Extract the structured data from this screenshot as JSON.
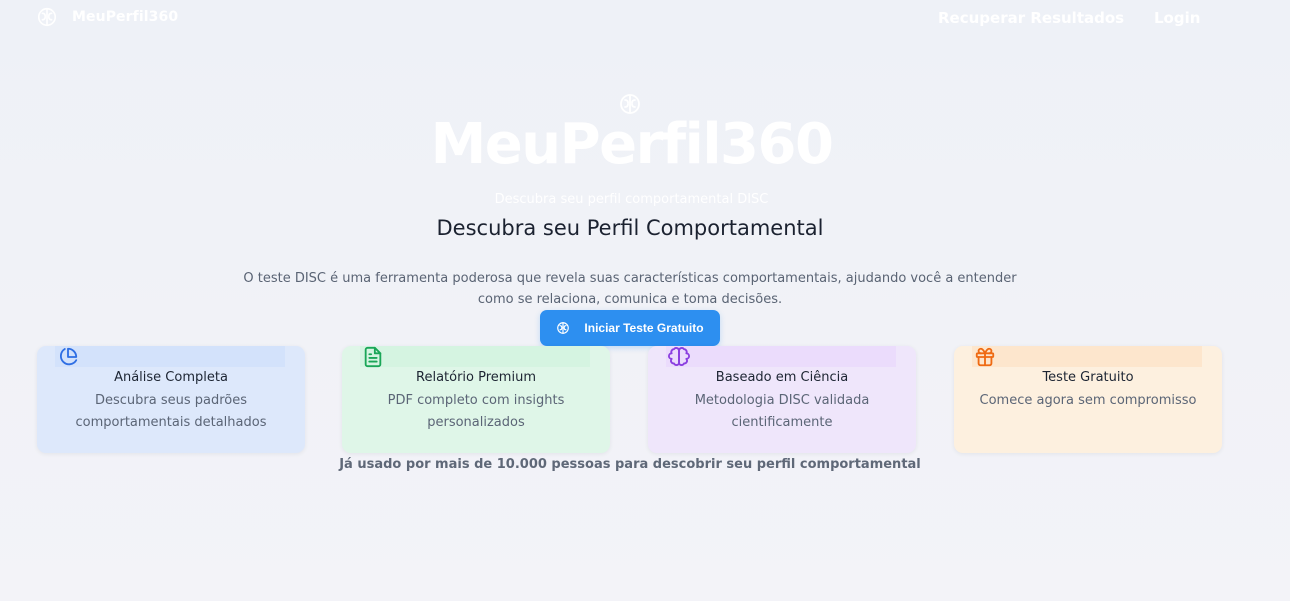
{
  "nav": {
    "brand": "MeuPerfil360",
    "brand_icon": "brain-icon",
    "links": [
      "Recuperar Resultados",
      "Login"
    ]
  },
  "hero": {
    "icon": "brain-icon",
    "title": "MeuPerfil360",
    "subtitle": "Descubra seu perfil comportamental DISC"
  },
  "main": {
    "heading": "Descubra seu Perfil Comportamental",
    "description": "O teste DISC é uma ferramenta poderosa que revela suas características comportamentais, ajudando você a entender como se relaciona, comunica e toma decisões.",
    "cta_label": "Iniciar Teste Gratuito",
    "cta_icon": "brain-icon"
  },
  "features": [
    {
      "icon": "pie-chart-icon",
      "title": "Análise Completa",
      "text": "Descubra seus padrões comportamentais detalhados",
      "accent": "#2f6fe4"
    },
    {
      "icon": "file-text-icon",
      "title": "Relatório Premium",
      "text": "PDF completo com insights personalizados",
      "accent": "#1aa657"
    },
    {
      "icon": "brain-icon",
      "title": "Baseado em Ciência",
      "text": "Metodologia DISC validada cientificamente",
      "accent": "#8b3fe0"
    },
    {
      "icon": "gift-icon",
      "title": "Teste Gratuito",
      "text": "Comece agora sem compromisso",
      "accent": "#ef6a12"
    }
  ],
  "footer_note": "Já usado por mais de 10.000 pessoas para descobrir seu perfil comportamental",
  "colors": {
    "cta": "#2d8ff0",
    "heading": "#1b2230",
    "body_text": "#5a6474"
  }
}
